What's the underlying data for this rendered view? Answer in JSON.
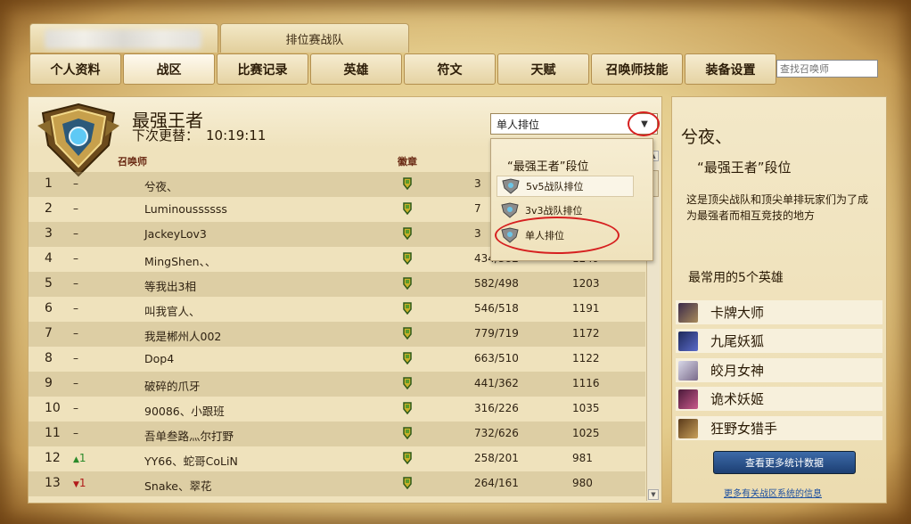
{
  "top_tabs": {
    "blurred_tab": "",
    "team_tab": "排位赛战队"
  },
  "nav": {
    "items": [
      "个人资料",
      "战区",
      "比赛记录",
      "英雄",
      "符文",
      "天赋",
      "召唤师技能",
      "装备设置"
    ],
    "active": "战区",
    "search_placeholder": "查找召唤师"
  },
  "ladder": {
    "tier_name": "最强王者",
    "next_update_label": "下次更替：",
    "next_update_time": "10:19:11",
    "queue_selected": "单人排位",
    "columns": {
      "summoner": "召唤师",
      "badge": "徽章"
    },
    "rows": [
      {
        "rank": "1",
        "change": "–",
        "change_dir": "none",
        "name": "兮夜、",
        "wl": "3",
        "pts": ""
      },
      {
        "rank": "2",
        "change": "–",
        "change_dir": "none",
        "name": "Luminoussssss",
        "wl": "7",
        "pts": ""
      },
      {
        "rank": "3",
        "change": "–",
        "change_dir": "none",
        "name": "JackeyLov3",
        "wl": "3",
        "pts": ""
      },
      {
        "rank": "4",
        "change": "–",
        "change_dir": "none",
        "name": "MingShen、、",
        "wl": "434/382",
        "pts": "1249"
      },
      {
        "rank": "5",
        "change": "–",
        "change_dir": "none",
        "name": "等我出3相",
        "wl": "582/498",
        "pts": "1203"
      },
      {
        "rank": "6",
        "change": "–",
        "change_dir": "none",
        "name": "叫我官人、",
        "wl": "546/518",
        "pts": "1191"
      },
      {
        "rank": "7",
        "change": "–",
        "change_dir": "none",
        "name": "我是郴州人002",
        "wl": "779/719",
        "pts": "1172"
      },
      {
        "rank": "8",
        "change": "–",
        "change_dir": "none",
        "name": "Dop4",
        "wl": "663/510",
        "pts": "1122"
      },
      {
        "rank": "9",
        "change": "–",
        "change_dir": "none",
        "name": "破碎的爪牙",
        "wl": "441/362",
        "pts": "1116"
      },
      {
        "rank": "10",
        "change": "–",
        "change_dir": "none",
        "name": "90086、小跟班",
        "wl": "316/226",
        "pts": "1035"
      },
      {
        "rank": "11",
        "change": "–",
        "change_dir": "none",
        "name": "吾单叁路灬尔打野",
        "wl": "732/626",
        "pts": "1025"
      },
      {
        "rank": "12",
        "change": "1",
        "change_dir": "up",
        "name": "YY66、蛇哥CoLiN",
        "wl": "258/201",
        "pts": "981"
      },
      {
        "rank": "13",
        "change": "1",
        "change_dir": "down",
        "name": "Snake、翠花",
        "wl": "264/161",
        "pts": "980"
      }
    ]
  },
  "queue_popup": {
    "title": "“最强王者”段位",
    "items": [
      "5v5战队排位",
      "3v3战队排位",
      "单人排位"
    ]
  },
  "side": {
    "name": "兮夜、",
    "tier_line": "“最强王者”段位",
    "description": "这是顶尖战队和顶尖单排玩家们为了成为最强者而相互竞技的地方",
    "favorites_title": "最常用的5个英雄",
    "champions": [
      "卡牌大师",
      "九尾妖狐",
      "皎月女神",
      "诡术妖姬",
      "狂野女猎手"
    ],
    "more_button": "查看更多统计数据",
    "more_link": "更多有关战区系统的信息"
  },
  "colors": {
    "accent_red": "#d62020",
    "button_blue": "#2a4f8a",
    "link_blue": "#1c4fa0",
    "parchment": "#efe2bc"
  }
}
